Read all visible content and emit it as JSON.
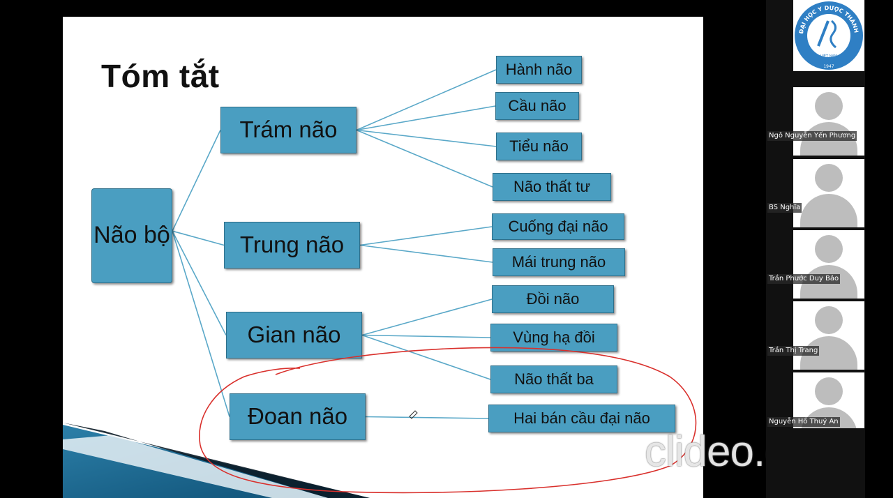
{
  "slide": {
    "title": "Tóm tắt",
    "root": "Não bộ",
    "branches": [
      {
        "label": "Trám não",
        "children": [
          "Hành não",
          "Cầu não",
          "Tiểu não",
          "Não thất tư"
        ]
      },
      {
        "label": "Trung não",
        "children": [
          "Cuống đại não",
          "Mái trung não"
        ]
      },
      {
        "label": "Gian não",
        "children": [
          "Đồi não",
          "Vùng hạ đồi",
          "Não thất ba"
        ]
      },
      {
        "label": "Đoan não",
        "children": [
          "Hai bán cầu đại não"
        ]
      }
    ]
  },
  "watermark": "clideo.com",
  "logo": {
    "arc_text": "ĐẠI HỌC Y DƯỢC THÀNH PHỐ HỒ CHÍ MINH",
    "country": "VIỆT NAM",
    "year": "1947"
  },
  "participants": [
    {
      "name": "Ngô Nguyễn Yến Phương"
    },
    {
      "name": "BS Nghĩa"
    },
    {
      "name": "Trần Phước Duy Bảo"
    },
    {
      "name": "Trần Thị Trang"
    },
    {
      "name": "Nguyễn Hồ Thuý An"
    }
  ],
  "colors": {
    "box_fill": "#4a9ec1",
    "box_border": "#2f6f8a",
    "connector": "#5aa8c8",
    "annotation": "#d9302c",
    "background": "#000000"
  }
}
